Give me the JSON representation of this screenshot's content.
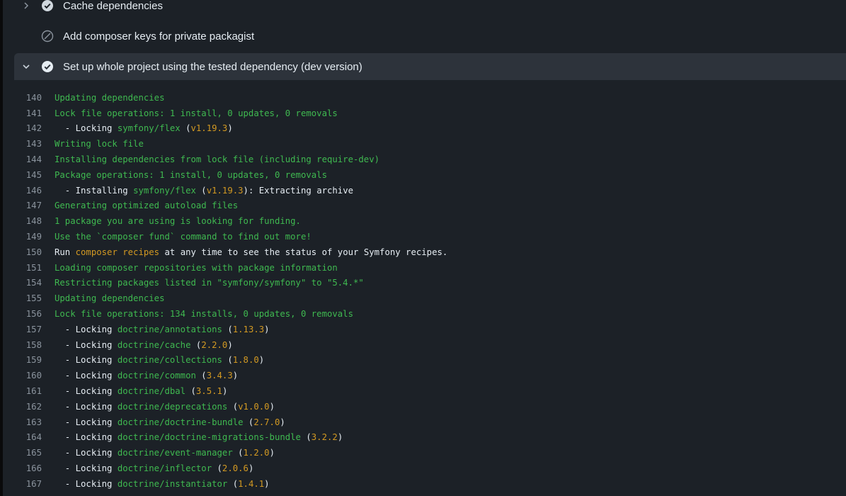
{
  "colors": {
    "green": "#3fb950",
    "yellow": "#d29922",
    "text": "#e6edf3",
    "muted": "#8b949e",
    "bg": "#1c2127",
    "expanded_bg": "#2d333b"
  },
  "steps": [
    {
      "label": "Cache dependencies",
      "status": "success-icon",
      "chevron": "chevron-right-icon"
    },
    {
      "label": "Add composer keys for private packagist",
      "status": "skipped-icon",
      "chevron": ""
    },
    {
      "label": "Set up whole project using the tested dependency (dev version)",
      "status": "success-icon",
      "chevron": "chevron-down-icon"
    }
  ],
  "log_lines": [
    {
      "n": "140",
      "segs": [
        [
          "g",
          "Updating dependencies"
        ]
      ]
    },
    {
      "n": "141",
      "segs": [
        [
          "g",
          "Lock file operations: 1 install, 0 updates, 0 removals"
        ]
      ]
    },
    {
      "n": "142",
      "segs": [
        [
          "w",
          "  - Locking "
        ],
        [
          "g",
          "symfony/flex"
        ],
        [
          "w",
          " ("
        ],
        [
          "y",
          "v1.19.3"
        ],
        [
          "w",
          ")"
        ]
      ]
    },
    {
      "n": "143",
      "segs": [
        [
          "g",
          "Writing lock file"
        ]
      ]
    },
    {
      "n": "144",
      "segs": [
        [
          "g",
          "Installing dependencies from lock file (including require-dev)"
        ]
      ]
    },
    {
      "n": "145",
      "segs": [
        [
          "g",
          "Package operations: 1 install, 0 updates, 0 removals"
        ]
      ]
    },
    {
      "n": "146",
      "segs": [
        [
          "w",
          "  - Installing "
        ],
        [
          "g",
          "symfony/flex"
        ],
        [
          "w",
          " ("
        ],
        [
          "y",
          "v1.19.3"
        ],
        [
          "w",
          "): Extracting archive"
        ]
      ]
    },
    {
      "n": "147",
      "segs": [
        [
          "g",
          "Generating optimized autoload files"
        ]
      ]
    },
    {
      "n": "148",
      "segs": [
        [
          "g",
          "1 package you are using is looking for funding."
        ]
      ]
    },
    {
      "n": "149",
      "segs": [
        [
          "g",
          "Use the `composer fund` command to find out more!"
        ]
      ]
    },
    {
      "n": "150",
      "segs": [
        [
          "w",
          "Run "
        ],
        [
          "y",
          "composer recipes"
        ],
        [
          "w",
          " at any time to see the status of your Symfony recipes."
        ]
      ]
    },
    {
      "n": "151",
      "segs": [
        [
          "g",
          "Loading composer repositories with package information"
        ]
      ]
    },
    {
      "n": "154",
      "segs": [
        [
          "g",
          "Restricting packages listed in \"symfony/symfony\" to \"5.4.*\""
        ]
      ]
    },
    {
      "n": "155",
      "segs": [
        [
          "g",
          "Updating dependencies"
        ]
      ]
    },
    {
      "n": "156",
      "segs": [
        [
          "g",
          "Lock file operations: 134 installs, 0 updates, 0 removals"
        ]
      ]
    },
    {
      "n": "157",
      "segs": [
        [
          "w",
          "  - Locking "
        ],
        [
          "g",
          "doctrine/annotations"
        ],
        [
          "w",
          " ("
        ],
        [
          "y",
          "1.13.3"
        ],
        [
          "w",
          ")"
        ]
      ]
    },
    {
      "n": "158",
      "segs": [
        [
          "w",
          "  - Locking "
        ],
        [
          "g",
          "doctrine/cache"
        ],
        [
          "w",
          " ("
        ],
        [
          "y",
          "2.2.0"
        ],
        [
          "w",
          ")"
        ]
      ]
    },
    {
      "n": "159",
      "segs": [
        [
          "w",
          "  - Locking "
        ],
        [
          "g",
          "doctrine/collections"
        ],
        [
          "w",
          " ("
        ],
        [
          "y",
          "1.8.0"
        ],
        [
          "w",
          ")"
        ]
      ]
    },
    {
      "n": "160",
      "segs": [
        [
          "w",
          "  - Locking "
        ],
        [
          "g",
          "doctrine/common"
        ],
        [
          "w",
          " ("
        ],
        [
          "y",
          "3.4.3"
        ],
        [
          "w",
          ")"
        ]
      ]
    },
    {
      "n": "161",
      "segs": [
        [
          "w",
          "  - Locking "
        ],
        [
          "g",
          "doctrine/dbal"
        ],
        [
          "w",
          " ("
        ],
        [
          "y",
          "3.5.1"
        ],
        [
          "w",
          ")"
        ]
      ]
    },
    {
      "n": "162",
      "segs": [
        [
          "w",
          "  - Locking "
        ],
        [
          "g",
          "doctrine/deprecations"
        ],
        [
          "w",
          " ("
        ],
        [
          "y",
          "v1.0.0"
        ],
        [
          "w",
          ")"
        ]
      ]
    },
    {
      "n": "163",
      "segs": [
        [
          "w",
          "  - Locking "
        ],
        [
          "g",
          "doctrine/doctrine-bundle"
        ],
        [
          "w",
          " ("
        ],
        [
          "y",
          "2.7.0"
        ],
        [
          "w",
          ")"
        ]
      ]
    },
    {
      "n": "164",
      "segs": [
        [
          "w",
          "  - Locking "
        ],
        [
          "g",
          "doctrine/doctrine-migrations-bundle"
        ],
        [
          "w",
          " ("
        ],
        [
          "y",
          "3.2.2"
        ],
        [
          "w",
          ")"
        ]
      ]
    },
    {
      "n": "165",
      "segs": [
        [
          "w",
          "  - Locking "
        ],
        [
          "g",
          "doctrine/event-manager"
        ],
        [
          "w",
          " ("
        ],
        [
          "y",
          "1.2.0"
        ],
        [
          "w",
          ")"
        ]
      ]
    },
    {
      "n": "166",
      "segs": [
        [
          "w",
          "  - Locking "
        ],
        [
          "g",
          "doctrine/inflector"
        ],
        [
          "w",
          " ("
        ],
        [
          "y",
          "2.0.6"
        ],
        [
          "w",
          ")"
        ]
      ]
    },
    {
      "n": "167",
      "segs": [
        [
          "w",
          "  - Locking "
        ],
        [
          "g",
          "doctrine/instantiator"
        ],
        [
          "w",
          " ("
        ],
        [
          "y",
          "1.4.1"
        ],
        [
          "w",
          ")"
        ]
      ]
    }
  ]
}
